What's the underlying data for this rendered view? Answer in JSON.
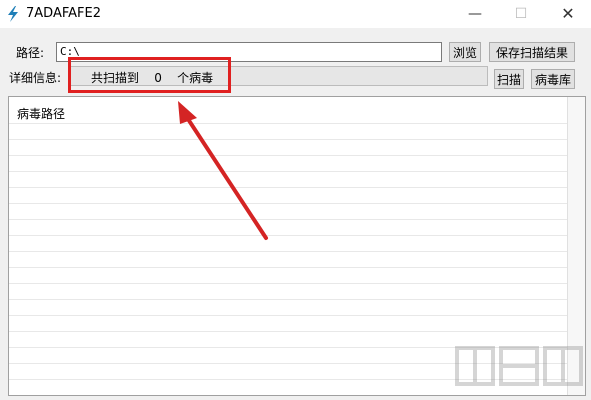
{
  "window": {
    "title": "7ADAFAFE2",
    "min_glyph": "—",
    "max_glyph": "☐",
    "close_glyph": "✕"
  },
  "path": {
    "label": "路径:",
    "value": "C:\\",
    "browse_label": "浏览",
    "save_label": "保存扫描结果"
  },
  "details": {
    "label": "详细信息:",
    "text": "共扫描到    0    个病毒",
    "scan_label": "扫描",
    "virus_db_label": "病毒库"
  },
  "list": {
    "header": "病毒路径"
  },
  "colors": {
    "highlight": "#e02020",
    "arrow": "#d42424"
  },
  "watermark": {
    "text": "下载吧"
  }
}
